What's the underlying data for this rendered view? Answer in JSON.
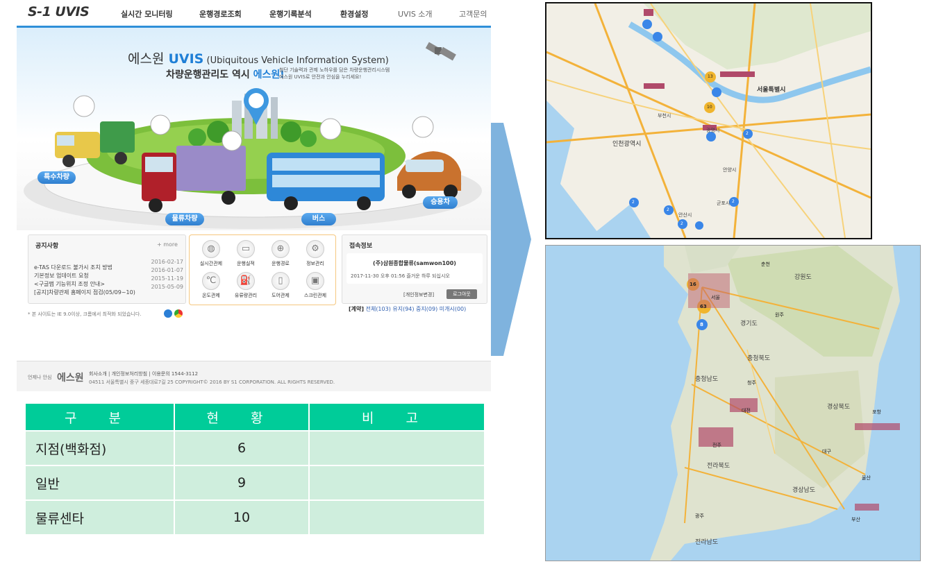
{
  "header": {
    "logo": "S-1 UVIS",
    "nav": [
      "실시간 모니터링",
      "운행경로조회",
      "운행기록분석",
      "환경설정",
      "UVIS 소개",
      "고객문의"
    ]
  },
  "hero": {
    "title_prefix": "에스원 ",
    "title_brand": "UVIS",
    "title_suffix": " (Ubiquitous Vehicle Information System)",
    "subtitle_prefix": "차량운행관리도 역시 ",
    "subtitle_brand": "에스원!",
    "desc_line1": "첨단 기술력과 관제 노하우를 담은 차량운행관리시스템",
    "desc_line2": "에스원 UVIS로 안전과 안심을 누리세요!",
    "vehicle_labels": [
      "특수차량",
      "물류차량",
      "버스",
      "승용차"
    ]
  },
  "notice": {
    "title": "공지사항",
    "more": "+ more",
    "items": [
      {
        "text": "e-TAS 다운로드 불가시 조치 방법",
        "date": "2016-02-17"
      },
      {
        "text": "기본정보 업데이트 요청",
        "date": "2016-01-07"
      },
      {
        "text": "<구글맵 기능위치 조정 안내>",
        "date": "2015-11-19"
      },
      {
        "text": "[공지]차량관제 홈페이지 점검(05/09~10)",
        "date": "2015-05-09"
      }
    ],
    "browser_note": "* 본 사이트는 IE 9.0이상, 크롬에서 최적화 되었습니다."
  },
  "quick_menu": [
    "실시간관제",
    "운행실적",
    "운행경로",
    "정보관리",
    "온도관제",
    "유류량관리",
    "도어관제",
    "스크린관제"
  ],
  "access": {
    "title": "접속정보",
    "company": "(주)삼원종합물류(samwon100)",
    "time": "2017-11-30 오후 01:56  즐거운 하루 되십시오",
    "edit_button": "[개인정보변경]",
    "logout_button": "로그아웃",
    "contract_label": "[계약]",
    "contract_stats": "전체(103) 유지(94) 중지(09) 미개시(00)"
  },
  "footer": {
    "slogan": "언제나 안심",
    "brand": "에스원",
    "links": "회사소개  |  개인정보처리방침  |  이용문의 1544-3112",
    "address": "04511 서울특별시 중구 세종대로7길 25   COPYRIGHT© 2016 BY S1 CORPORATION. ALL RIGHTS RESERVED."
  },
  "table": {
    "headers": [
      "구 분",
      "현 황",
      "비 고"
    ],
    "rows": [
      [
        "지점(백화점)",
        "6",
        ""
      ],
      [
        "일반",
        "9",
        ""
      ],
      [
        "물류센타",
        "10",
        ""
      ]
    ]
  },
  "map_top": {
    "labels": [
      "서울특별시",
      "인천광역시",
      "부천시",
      "광명시",
      "안양시",
      "군포시",
      "안산시"
    ],
    "clusters": [
      "13",
      "10",
      "2",
      "2",
      "2",
      "2",
      "2"
    ]
  },
  "map_bottom": {
    "labels": [
      "강원도",
      "경기도",
      "충청남도",
      "충청북도",
      "전라북도",
      "경상북도",
      "경상남도",
      "전라남도",
      "서울",
      "춘천",
      "원주",
      "대구",
      "울산",
      "부산",
      "광주",
      "전주",
      "대전",
      "청주",
      "포항"
    ],
    "clusters": [
      "16",
      "63",
      "8"
    ]
  },
  "colors": {
    "accent": "#1f7fd6",
    "table_header": "#00cc99",
    "table_cell": "#cfeedd",
    "arrow": "#7fb3de"
  }
}
